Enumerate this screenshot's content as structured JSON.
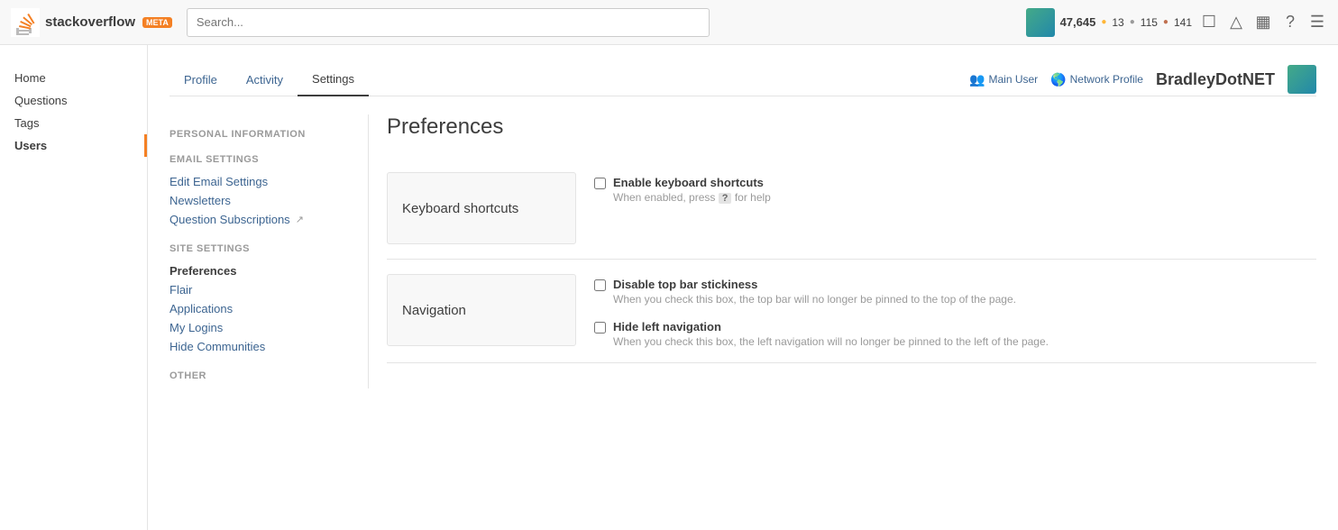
{
  "header": {
    "logo_text": "stackoverflow",
    "meta_badge": "META",
    "search_placeholder": "Search...",
    "rep_score": "47,645",
    "gold_count": "13",
    "silver_count": "115",
    "bronze_count": "141",
    "username": "BradleyDotNET"
  },
  "sidebar": {
    "items": [
      {
        "label": "Home",
        "active": false
      },
      {
        "label": "Questions",
        "active": false
      },
      {
        "label": "Tags",
        "active": false
      },
      {
        "label": "Users",
        "active": true
      }
    ]
  },
  "profile_tabs": {
    "tabs": [
      {
        "label": "Profile",
        "active": false
      },
      {
        "label": "Activity",
        "active": false
      },
      {
        "label": "Settings",
        "active": true
      }
    ],
    "main_user_label": "Main User",
    "network_profile_label": "Network Profile"
  },
  "settings_nav": {
    "personal_info_title": "PERSONAL INFORMATION",
    "email_settings_title": "EMAIL SETTINGS",
    "email_settings_items": [
      {
        "label": "Edit Email Settings",
        "active": false
      },
      {
        "label": "Newsletters",
        "active": false
      },
      {
        "label": "Question Subscriptions",
        "active": false,
        "external": true
      }
    ],
    "site_settings_title": "SITE SETTINGS",
    "site_settings_items": [
      {
        "label": "Preferences",
        "active": true
      },
      {
        "label": "Flair",
        "active": false
      },
      {
        "label": "Applications",
        "active": false
      },
      {
        "label": "My Logins",
        "active": false
      },
      {
        "label": "Hide Communities",
        "active": false
      }
    ],
    "other_title": "OTHER"
  },
  "preferences": {
    "title": "Preferences",
    "sections": [
      {
        "card_label": "Keyboard shortcuts",
        "options": [
          {
            "label": "Enable keyboard shortcuts",
            "description_before": "When enabled, press",
            "description_key": "?",
            "description_after": "for help",
            "checked": false
          }
        ]
      },
      {
        "card_label": "Navigation",
        "options": [
          {
            "label": "Disable top bar stickiness",
            "description": "When you check this box, the top bar will no longer be pinned to the top of the page.",
            "checked": false
          },
          {
            "label": "Hide left navigation",
            "description": "When you check this box, the left navigation will no longer be pinned to the left of the page.",
            "checked": false
          }
        ]
      }
    ]
  }
}
